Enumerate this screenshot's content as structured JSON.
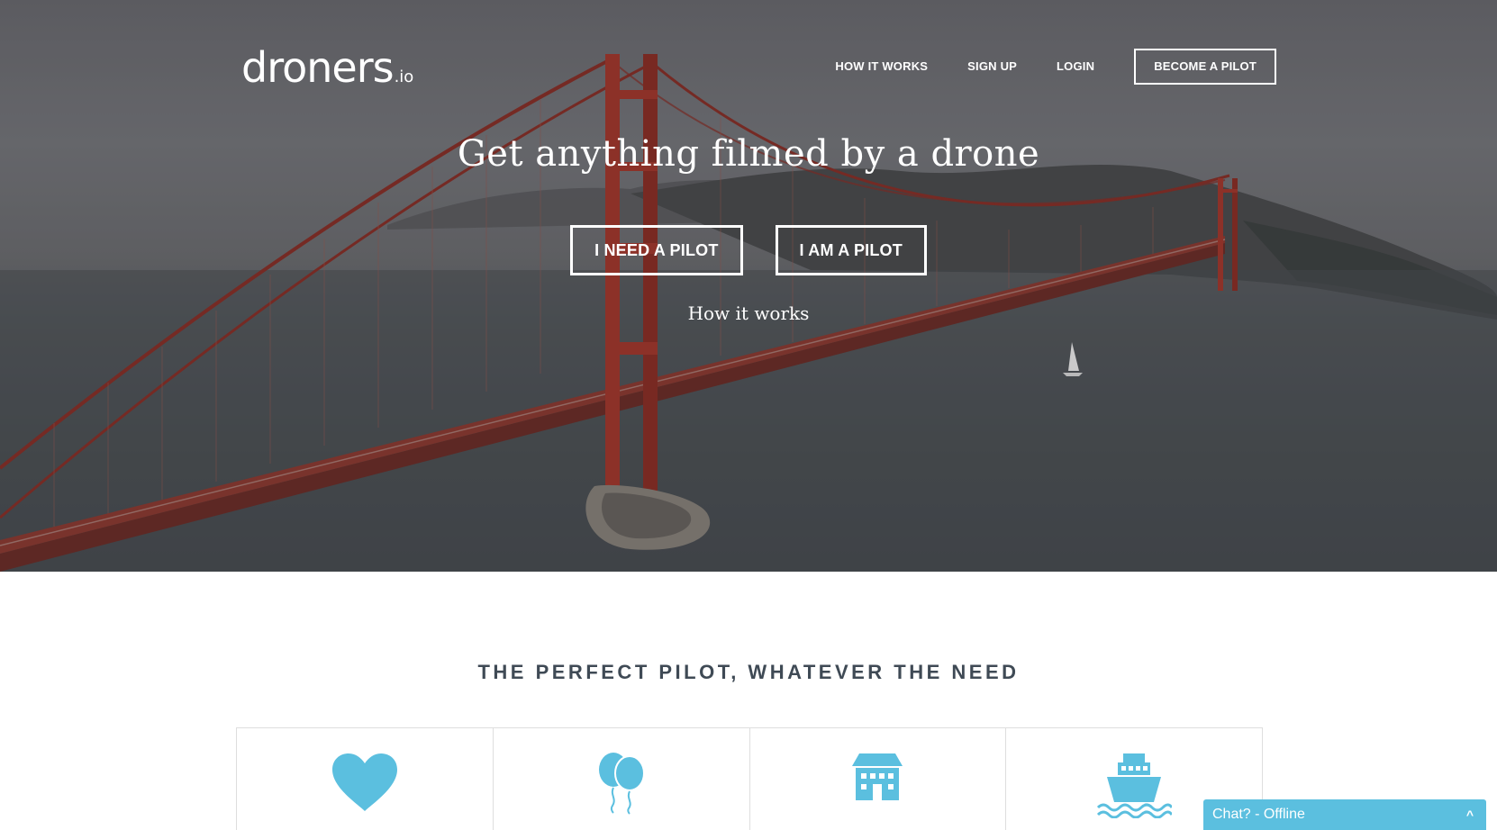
{
  "brand": {
    "name": "droners",
    "tld": ".io"
  },
  "nav": {
    "items": [
      "HOW IT WORKS",
      "SIGN UP",
      "LOGIN"
    ],
    "become_pilot": "BECOME A PILOT"
  },
  "hero": {
    "headline": "Get anything filmed by a drone",
    "cta_need": "I NEED A PILOT",
    "cta_am": "I AM A PILOT",
    "how_link": "How it works"
  },
  "section": {
    "title": "THE PERFECT PILOT, WHATEVER THE NEED",
    "cards": [
      {
        "icon": "heart-icon"
      },
      {
        "icon": "balloons-icon"
      },
      {
        "icon": "house-icon"
      },
      {
        "icon": "ship-icon"
      }
    ]
  },
  "chat": {
    "label": "Chat? - Offline",
    "chevron": "^"
  },
  "colors": {
    "accent": "#5bbfdf",
    "title": "#3f4a55",
    "bridge": "#b43a2c"
  }
}
